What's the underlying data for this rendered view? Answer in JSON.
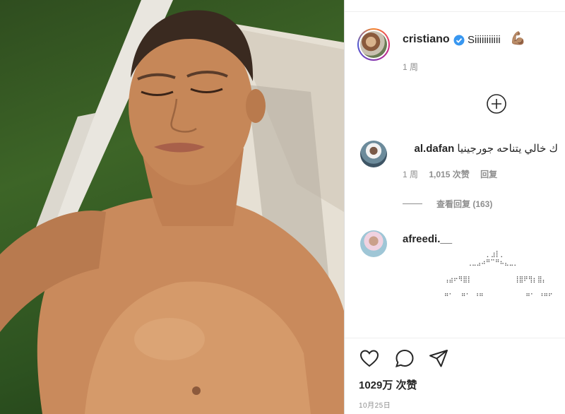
{
  "post": {
    "username": "cristiano",
    "caption": "Siiiiiiiiiii",
    "caption_emoji": "💪🏽",
    "time": "1 周"
  },
  "comments": [
    {
      "username": "al.dafan",
      "text": "ك خالي يتناحه جورجينيا",
      "time": "1 周",
      "likes": "1,015 次赞",
      "reply_label": "回复",
      "view_replies": "查看回复 (163)"
    },
    {
      "username": "afreedi.__",
      "ascii_art": "             ⡀⣰⡇⡀\n        ⢀⣀⣠⠴⠛⠉⠛⠦⣄⣀⡀\n\n  ⢠⣴⠖⠻⣿⡇           ⢸⣿⠟⢻⡆⣿⡄\n\n  ⠛⠁  ⠛⠁ ⠘⠛           ⠛⠁ ⠘⠛⠋"
    }
  ],
  "actions": {
    "like_icon": "heart-icon",
    "comment_icon": "comment-icon",
    "share_icon": "share-icon"
  },
  "likes_total": "1029万 次赞",
  "date": "10月25日",
  "colors": {
    "verified": "#3897f0",
    "muted": "#8e8e8e",
    "text": "#262626"
  }
}
